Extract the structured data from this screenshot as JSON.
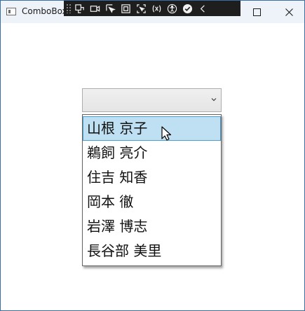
{
  "window": {
    "title": "ComboBox"
  },
  "debug_toolbar": {
    "icons": [
      "grip-icon",
      "live-visual-tree-icon",
      "record-icon",
      "select-element-icon",
      "layout-adorner-icon",
      "track-focus-icon",
      "binding-failures-icon",
      "accessibility-icon",
      "checkmark-icon",
      "collapse-chevron-icon"
    ]
  },
  "combobox": {
    "selected_value": "",
    "items": [
      "山根 京子",
      "鵜飼 亮介",
      "住吉 知香",
      "岡本 徹",
      "岩澤 博志",
      "長谷部 美里"
    ],
    "highlighted_index": 0
  },
  "colors": {
    "highlight_bg": "#bfe0f2",
    "highlight_border": "#4a9fd0",
    "titlebar_bg": "#eef3fa",
    "debugbar_bg": "#1e1e1e"
  }
}
